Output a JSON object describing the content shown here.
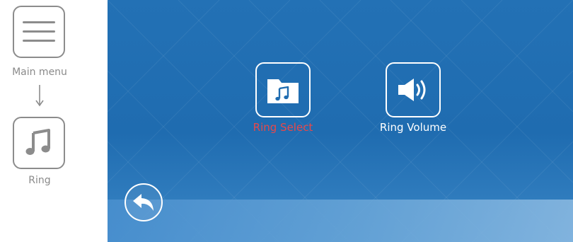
{
  "sidebar": {
    "items": [
      {
        "label": "Main menu",
        "icon": "hamburger-icon"
      },
      {
        "label": "Ring",
        "icon": "music-note-icon"
      }
    ],
    "arrow_icon": "arrow-down-icon"
  },
  "screen": {
    "tiles": [
      {
        "label": "Ring Select",
        "icon": "music-folder-icon",
        "selected": true
      },
      {
        "label": "Ring Volume",
        "icon": "speaker-volume-icon",
        "selected": false
      }
    ],
    "back_icon": "back-arrow-icon"
  },
  "colors": {
    "screen_blue": "#2371b5",
    "selected_label": "#e8484a",
    "tile_border": "#ffffff",
    "sidebar_border": "#8c8c8c",
    "sidebar_text": "#8a8a8a"
  }
}
